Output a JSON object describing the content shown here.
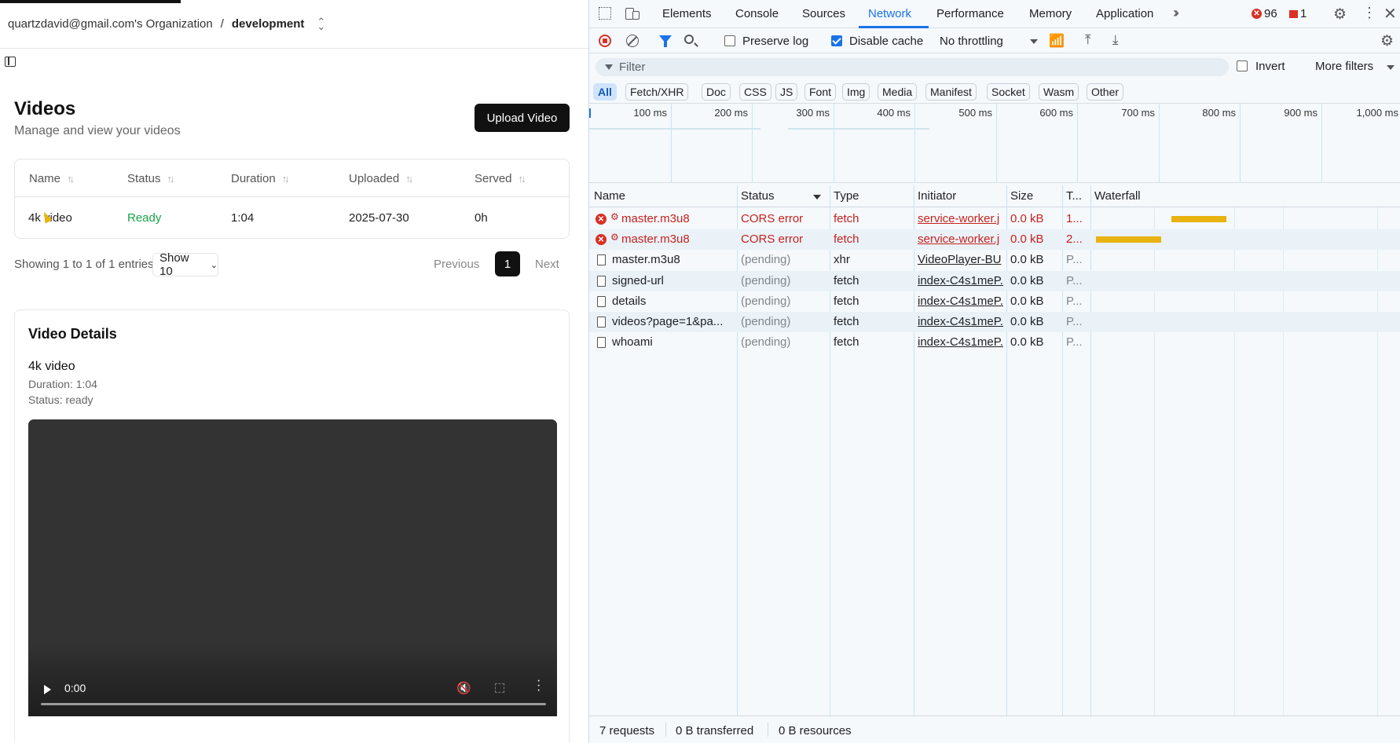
{
  "app": {
    "org": "quartzdavid@gmail.com's Organization",
    "separator": "/",
    "project": "development",
    "title": "Videos",
    "subtitle": "Manage and view your videos",
    "upload_label": "Upload Video",
    "table": {
      "headers": [
        "Name",
        "Status",
        "Duration",
        "Uploaded",
        "Served"
      ],
      "rows": [
        {
          "name": "4k video",
          "status": "Ready",
          "duration": "1:04",
          "uploaded": "2025-07-30",
          "served": "0h"
        }
      ]
    },
    "entries": "Showing 1 to 1 of 1 entries",
    "show_select": "Show 10",
    "pagination": {
      "previous": "Previous",
      "page": "1",
      "next": "Next"
    },
    "details": {
      "title": "Video Details",
      "name": "4k video",
      "duration": "Duration: 1:04",
      "status": "Status: ready",
      "player_time": "0:00"
    }
  },
  "devtools": {
    "tabs": [
      "Elements",
      "Console",
      "Sources",
      "Network",
      "Performance",
      "Memory",
      "Application"
    ],
    "active_tab": "Network",
    "error_count": "96",
    "warning_count": "1",
    "toolbar": {
      "preserve_log": "Preserve log",
      "preserve_log_checked": false,
      "disable_cache": "Disable cache",
      "disable_cache_checked": true,
      "throttling": "No throttling"
    },
    "filter_placeholder": "Filter",
    "invert": "Invert",
    "more_filters": "More filters",
    "type_filters": [
      "All",
      "Fetch/XHR",
      "Doc",
      "CSS",
      "JS",
      "Font",
      "Img",
      "Media",
      "Manifest",
      "Socket",
      "Wasm",
      "Other"
    ],
    "active_type": "All",
    "timeline_ticks": [
      "100 ms",
      "200 ms",
      "300 ms",
      "400 ms",
      "500 ms",
      "600 ms",
      "700 ms",
      "800 ms",
      "900 ms",
      "1,000 ms"
    ],
    "columns": [
      "Name",
      "Status",
      "Type",
      "Initiator",
      "Size",
      "T...",
      "Waterfall"
    ],
    "requests": [
      {
        "name": "master.m3u8",
        "status": "CORS error",
        "type": "fetch",
        "initiator": "service-worker.j",
        "size": "0.0 kB",
        "time": "1...",
        "error": true
      },
      {
        "name": "master.m3u8",
        "status": "CORS error",
        "type": "fetch",
        "initiator": "service-worker.j",
        "size": "0.0 kB",
        "time": "2...",
        "error": true
      },
      {
        "name": "master.m3u8",
        "status": "(pending)",
        "type": "xhr",
        "initiator": "VideoPlayer-BU",
        "size": "0.0 kB",
        "time": "P...",
        "error": false
      },
      {
        "name": "signed-url",
        "status": "(pending)",
        "type": "fetch",
        "initiator": "index-C4s1meP.",
        "size": "0.0 kB",
        "time": "P...",
        "error": false
      },
      {
        "name": "details",
        "status": "(pending)",
        "type": "fetch",
        "initiator": "index-C4s1meP.",
        "size": "0.0 kB",
        "time": "P...",
        "error": false
      },
      {
        "name": "videos?page=1&pa...",
        "status": "(pending)",
        "type": "fetch",
        "initiator": "index-C4s1meP.",
        "size": "0.0 kB",
        "time": "P...",
        "error": false
      },
      {
        "name": "whoami",
        "status": "(pending)",
        "type": "fetch",
        "initiator": "index-C4s1meP.",
        "size": "0.0 kB",
        "time": "P...",
        "error": false
      }
    ],
    "status_bar": {
      "requests": "7 requests",
      "transferred": "0 B transferred",
      "resources": "0 B resources"
    },
    "colors": {
      "accent": "#1a73e8",
      "error": "#d93025",
      "waterfall": "#e8b210"
    }
  }
}
